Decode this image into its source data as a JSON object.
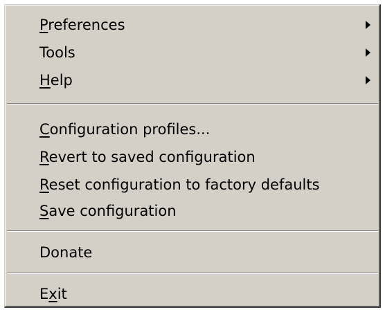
{
  "menu": {
    "items": [
      {
        "pre": "",
        "ul": "P",
        "post": "references",
        "submenu": true
      },
      {
        "pre": "",
        "ul": "",
        "post": "Tools",
        "submenu": true
      },
      {
        "pre": "",
        "ul": "H",
        "post": "elp",
        "submenu": true
      },
      {
        "pre": "",
        "ul": "C",
        "post": "onfiguration profiles...",
        "submenu": false
      },
      {
        "pre": "",
        "ul": "R",
        "post": "evert to saved configuration",
        "submenu": false
      },
      {
        "pre": "",
        "ul": "R",
        "post": "eset configuration to factory defaults",
        "submenu": false
      },
      {
        "pre": "",
        "ul": "S",
        "post": "ave configuration",
        "submenu": false
      },
      {
        "pre": "",
        "ul": "",
        "post": "Donate",
        "submenu": false
      },
      {
        "pre": "E",
        "ul": "x",
        "post": "it",
        "submenu": false
      }
    ]
  },
  "icons": {
    "submenu_arrow": "chevron-right-icon"
  },
  "colors": {
    "menu_background": "#d4d0c8",
    "separator_dark": "#808080",
    "separator_light": "#ffffff",
    "text": "#000000"
  }
}
